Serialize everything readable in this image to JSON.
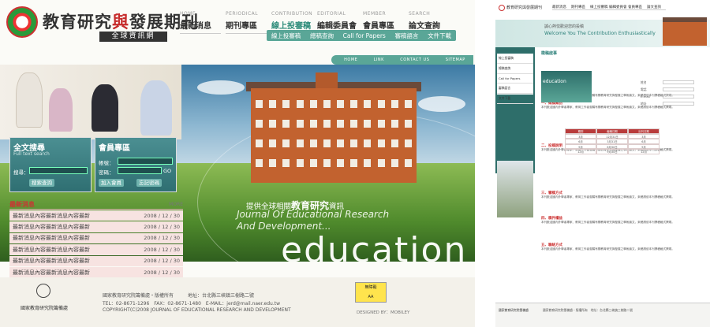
{
  "colors": {
    "accent": "#5aa697",
    "brand_red": "#c62a2a",
    "news_row": "#f7e3e1"
  },
  "header": {
    "logo_title_a": "教育研究",
    "logo_title_b": "與",
    "logo_title_c": "發展期刊",
    "logo_sub": "全球資訊網",
    "nav": [
      {
        "en": "HOME",
        "zh": "最新消息"
      },
      {
        "en": "PERIODICAL",
        "zh": "期刊專區"
      },
      {
        "en": "CONTRIBUTION",
        "zh": "線上投審稿"
      },
      {
        "en": "EDITORIAL",
        "zh": "編輯委員會"
      },
      {
        "en": "MEMBER",
        "zh": "會員專區"
      },
      {
        "en": "SEARCH",
        "zh": "論文查詢"
      }
    ],
    "subnav": [
      "線上投審稿",
      "總稿查詢",
      "Call for Papers",
      "審稿語言",
      "文件下載"
    ],
    "topbar": [
      "HOME",
      "LINK",
      "CONTACT US",
      "SITEMAP"
    ]
  },
  "hero": {
    "zh": "提供全球相關",
    "zh_bold": "教育研究",
    "zh_tail": "資訊",
    "en1": "Journal Of Educational Research",
    "en2": "And Development...",
    "edu": "education"
  },
  "search_panel": {
    "title": "全文搜尋",
    "sub": "Full text search",
    "label": "搜尋：",
    "button": "搜索查詢"
  },
  "member_panel": {
    "title": "會員專區",
    "account_label": "帳號：",
    "password_label": "密碼：",
    "go": "GO",
    "join": "加入會員",
    "forgot": "忘記密碼"
  },
  "news": {
    "title": "最新消息",
    "more": "MORE",
    "rows": [
      {
        "text": "最新消息內容最新消息內容最新",
        "date": "2008 / 12 / 30"
      },
      {
        "text": "最新消息內容最新消息內容最新",
        "date": "2008 / 12 / 30"
      },
      {
        "text": "最新消息內容最新消息內容最新",
        "date": "2008 / 12 / 30"
      },
      {
        "text": "最新消息內容最新消息內容最新",
        "date": "2008 / 12 / 30"
      },
      {
        "text": "最新消息內容最新消息內容最新",
        "date": "2008 / 12 / 30"
      },
      {
        "text": "最新消息內容最新消息內容最新",
        "date": "2008 / 12 / 30"
      }
    ]
  },
  "footer": {
    "name": "國家教育研究院籌備處",
    "line1": "國家教育研究院籌備處・版權所有　　　地址：台北縣三峽鎮三樹路二號",
    "line2": "TEL：02-8671-1296　FAX：02-8671-1480　E-MAIL：jerd@mail.naer.edu.tw",
    "line3": "COPYRIGHT(C)2008 JOURNAL OF EDUCATIONAL RESEARCH AND DEVELOPMENT",
    "badge1": "無障礙",
    "badge2": "AA",
    "designed": "DESIGNED BY：MOBILEY"
  },
  "right": {
    "title": "教育研究與發展期刊",
    "nav": [
      "最新消息",
      "期刊專區",
      "線上投審稿",
      "編輯委員會",
      "會員專區",
      "論文查詢"
    ],
    "welcome_zh": "誠心熱忱歡迎您的投稿",
    "welcome_en": "Welcome You The Contribution Enthusiastically",
    "side_items": [
      "線上投審稿",
      "總稿查詢",
      "Call for Papers",
      "審稿語言",
      "文件下載"
    ],
    "heading": "徵稿啟事",
    "sec1": "一、徵稿類別",
    "sec2": "二、投稿說明",
    "sec3": "三、審稿方式",
    "sec4": "四、稿件權益",
    "sec5": "五、聯絡方式",
    "body": "本刊歡迎國內外學者專家、教育工作者惠賜有關教育研究與發展之學術論文，來稿請依本刊撰稿格式撰寫。",
    "form": [
      "姓名",
      "電話",
      "E-mail",
      "地址"
    ],
    "table_head": [
      "期別",
      "截稿日期",
      "出刊日期"
    ],
    "table_rows": [
      [
        "3月",
        "12月31日",
        "3月"
      ],
      [
        "6月",
        "3月31日",
        "6月"
      ],
      [
        "9月",
        "6月30日",
        "9月"
      ],
      [
        "12月",
        "9月30日",
        "12月"
      ]
    ],
    "footer_name": "國家教育研究院籌備處",
    "footer_text": "國家教育研究院籌備處・版權所有　地址：台北縣三峽鎮三樹路二號"
  }
}
